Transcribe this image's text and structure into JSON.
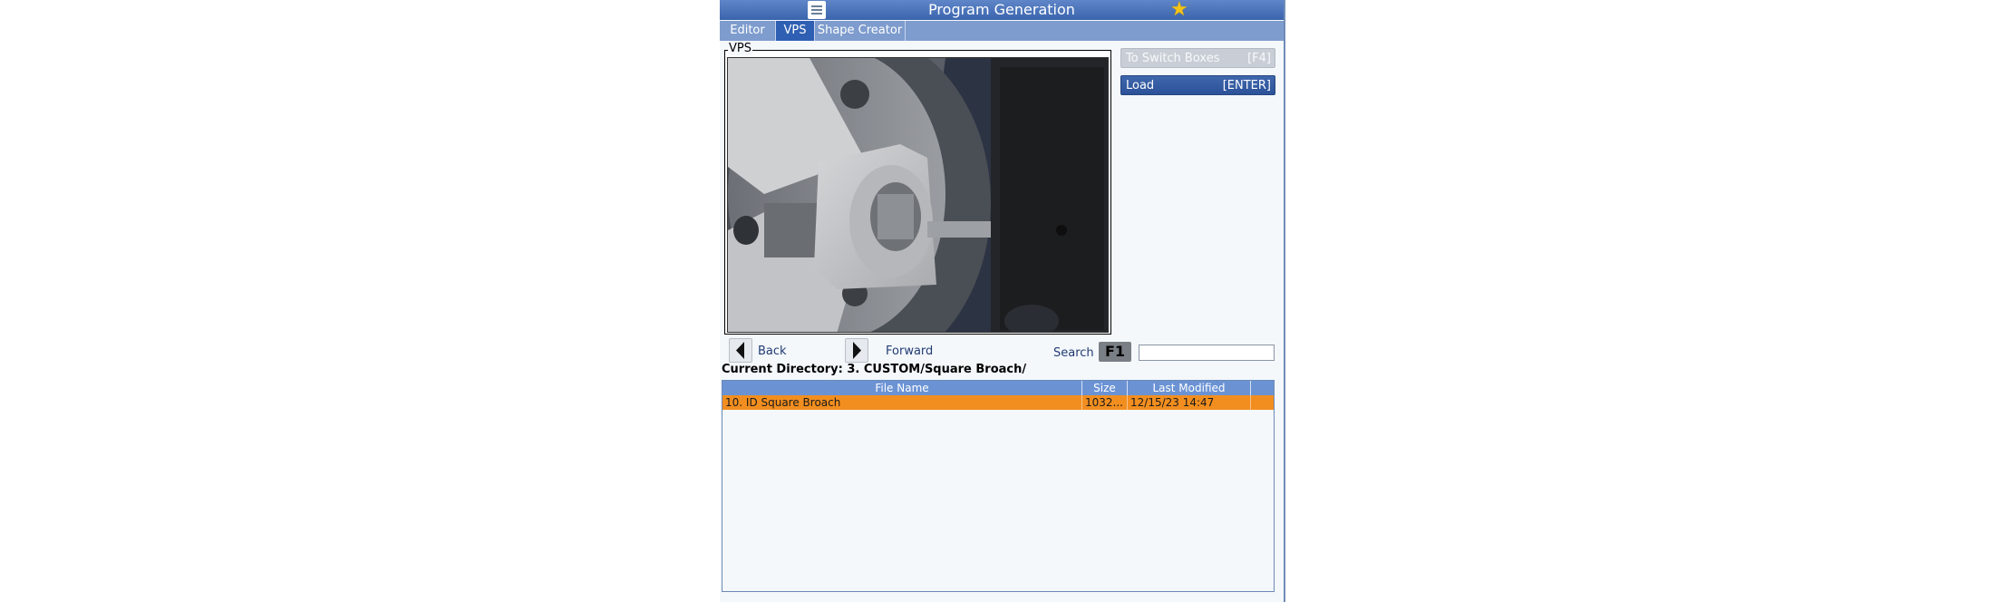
{
  "window": {
    "title": "Program Generation"
  },
  "tabs": [
    {
      "label": "Editor",
      "active": false
    },
    {
      "label": "VPS",
      "active": true
    },
    {
      "label": "Shape Creator",
      "active": false
    }
  ],
  "vps": {
    "legend": "VPS"
  },
  "buttons": {
    "switch": {
      "label": "To Switch Boxes",
      "key": "[F4]"
    },
    "load": {
      "label": "Load",
      "key": "[ENTER]"
    }
  },
  "nav": {
    "back": "Back",
    "forward": "Forward"
  },
  "search": {
    "label": "Search",
    "key": "F1",
    "value": ""
  },
  "current_directory": "Current Directory: 3. CUSTOM/Square Broach/",
  "table": {
    "headers": [
      "File Name",
      "Size",
      "Last Modified"
    ],
    "rows": [
      {
        "name": "10. ID Square Broach",
        "size": "1032...",
        "modified": "12/15/23 14:47",
        "selected": true
      }
    ]
  },
  "colors": {
    "accent": "#2f5fb3",
    "selected_row": "#f28e1f",
    "favorite": "#f2c318"
  }
}
